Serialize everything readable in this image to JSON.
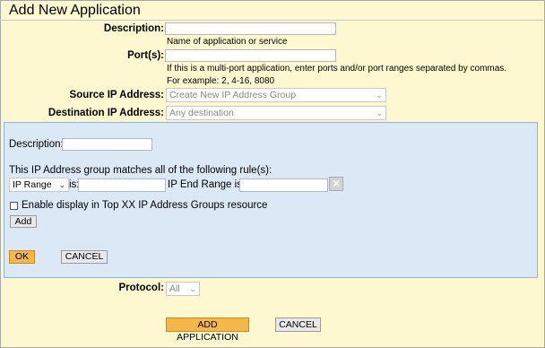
{
  "window": {
    "title": "Add New Application"
  },
  "form": {
    "description_label": "Description:",
    "description_value": "",
    "description_hint": "Name of application or service",
    "ports_label": "Port(s):",
    "ports_value": "",
    "ports_hint_1": "If this is a multi-port application, enter ports and/or port ranges separated by commas.",
    "ports_hint_2": "For example: 2, 4-16, 8080",
    "source_ip_label": "Source IP Address:",
    "source_ip_selected": "Create New IP Address Group",
    "dest_ip_label": "Destination IP Address:",
    "dest_ip_selected": "Any destination",
    "protocol_label": "Protocol:",
    "protocol_selected": "All"
  },
  "group_panel": {
    "description_label": "Description:",
    "description_value": "",
    "rules_text": "This IP Address group matches all of the following rule(s):",
    "rule_type_selected": "IP Range",
    "is_label_1": "is:",
    "start_value": "",
    "end_label": "IP End Range is:",
    "end_value": "",
    "enable_display_label": "Enable display in Top XX IP Address Groups resource",
    "enable_display_checked": false,
    "add_button": "Add",
    "ok_button": "OK",
    "cancel_button": "CANCEL"
  },
  "footer": {
    "add_application_button": "ADD APPLICATION",
    "cancel_button": "CANCEL"
  },
  "icons": {
    "dropdown": "chevron-down-icon",
    "clear": "close-icon",
    "checkbox": "checkbox-icon"
  },
  "colors": {
    "page_bg": "#fdf8cf",
    "panel_bg": "#dbe9f7",
    "primary_button": "#f6b74a"
  }
}
